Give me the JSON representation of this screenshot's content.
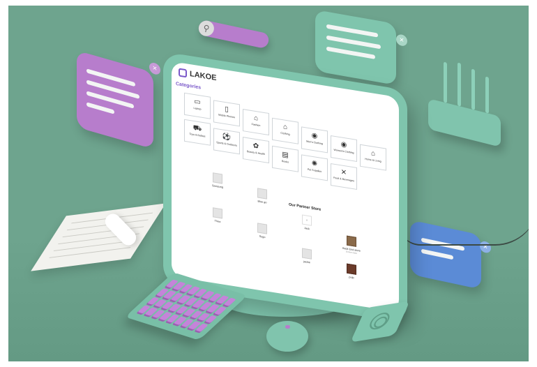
{
  "screen": {
    "brand": "LAKOE",
    "categories_title": "Categories",
    "categories": [
      {
        "label": "Laptop",
        "icon": "laptop-icon"
      },
      {
        "label": "Mobile Phones",
        "icon": "phone-icon"
      },
      {
        "label": "Fashion",
        "icon": "hanger-icon"
      },
      {
        "label": "Clothing",
        "icon": "hanger-icon"
      },
      {
        "label": "Men's Clothing",
        "icon": "shirt-icon"
      },
      {
        "label": "Women's Clothing",
        "icon": "dress-icon"
      },
      {
        "label": "Home & Living",
        "icon": "home-icon"
      },
      {
        "label": "Toys & Babies",
        "icon": "truck-icon"
      },
      {
        "label": "Sports & Outdoors",
        "icon": "ball-icon"
      },
      {
        "label": "Beauty & Health",
        "icon": "flower-icon"
      },
      {
        "label": "Books",
        "icon": "book-icon"
      },
      {
        "label": "Pet Supplies",
        "icon": "paw-icon"
      },
      {
        "label": "Food & Beverages",
        "icon": "utensils-icon"
      }
    ],
    "partner_title": "Our Partner Store",
    "partners": [
      {
        "name": "Samsung",
        "sub": ""
      },
      {
        "name": "Blue go",
        "sub": ""
      },
      {
        "name": "Jack",
        "sub": ""
      },
      {
        "name": "Thea",
        "sub": ""
      },
      {
        "name": "Sogo",
        "sub": ""
      },
      {
        "name": "Back End store",
        "sub": "Online store"
      },
      {
        "name": "jackie",
        "sub": ""
      },
      {
        "name": "pulp",
        "sub": ""
      }
    ]
  },
  "colors": {
    "background": "#6ea48e",
    "mint": "#7fc5ad",
    "purple": "#b77dcc",
    "blue": "#5b8bd6"
  }
}
